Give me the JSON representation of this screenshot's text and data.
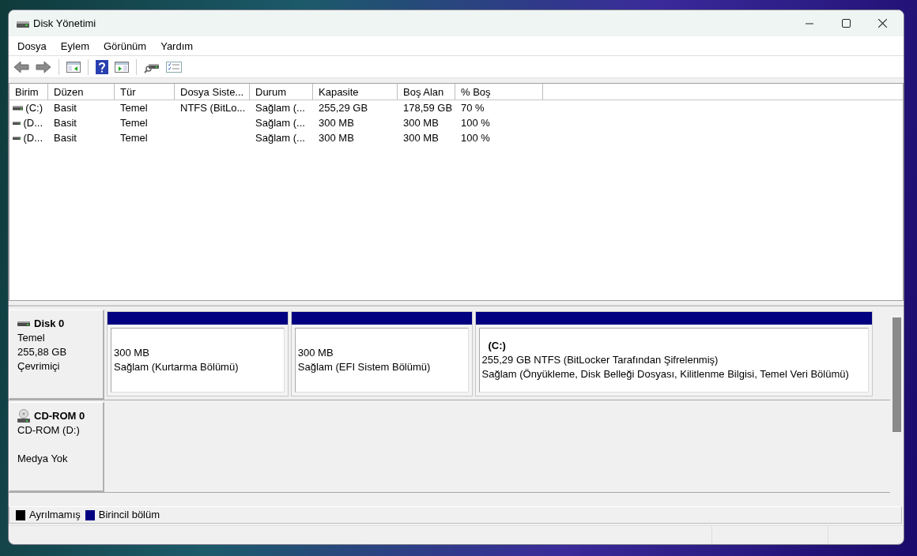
{
  "window": {
    "title": "Disk Yönetimi"
  },
  "menu": [
    "Dosya",
    "Eylem",
    "Görünüm",
    "Yardım"
  ],
  "table": {
    "columns": [
      "Birim",
      "Düzen",
      "Tür",
      "Dosya Siste...",
      "Durum",
      "Kapasite",
      "Boş Alan",
      "% Boş"
    ],
    "rows": [
      {
        "volume": "(C:)",
        "layout": "Basit",
        "type": "Temel",
        "file_system": "NTFS (BitLo...",
        "status": "Sağlam (...",
        "capacity": "255,29 GB",
        "free_space": "178,59 GB",
        "percent_free": "70 %"
      },
      {
        "volume": "(D...",
        "layout": "Basit",
        "type": "Temel",
        "status": "Sağlam (...",
        "capacity": "300 MB",
        "free_space": "300 MB",
        "percent_free": "100 %"
      },
      {
        "volume": "(D...",
        "layout": "Basit",
        "type": "Temel",
        "status": "Sağlam (...",
        "capacity": "300 MB",
        "free_space": "300 MB",
        "percent_free": "100 %"
      }
    ]
  },
  "disks": [
    {
      "kind": "disk",
      "name": "Disk 0",
      "type": "Temel",
      "size": "255,88 GB",
      "status": "Çevrimiçi",
      "partitions": [
        {
          "color": "#000080",
          "size": "300 MB",
          "status": "Sağlam (Kurtarma Bölümü)"
        },
        {
          "color": "#000080",
          "size": "300 MB",
          "status": "Sağlam (EFI Sistem Bölümü)"
        },
        {
          "color": "#000080",
          "label": "(C:)",
          "size": "255,29 GB NTFS (BitLocker Tarafından Şifrelenmiş)",
          "status": "Sağlam (Önyükleme, Disk Belleği Dosyası, Kilitlenme Bilgisi, Temel Veri Bölümü)"
        }
      ]
    },
    {
      "kind": "cdrom",
      "name": "CD-ROM 0",
      "type": "CD-ROM (D:)",
      "status": "Medya Yok"
    }
  ],
  "legend": [
    {
      "label": "Ayrılmamış",
      "color": "#000000"
    },
    {
      "label": "Birincil bölüm",
      "color": "#000080"
    }
  ]
}
